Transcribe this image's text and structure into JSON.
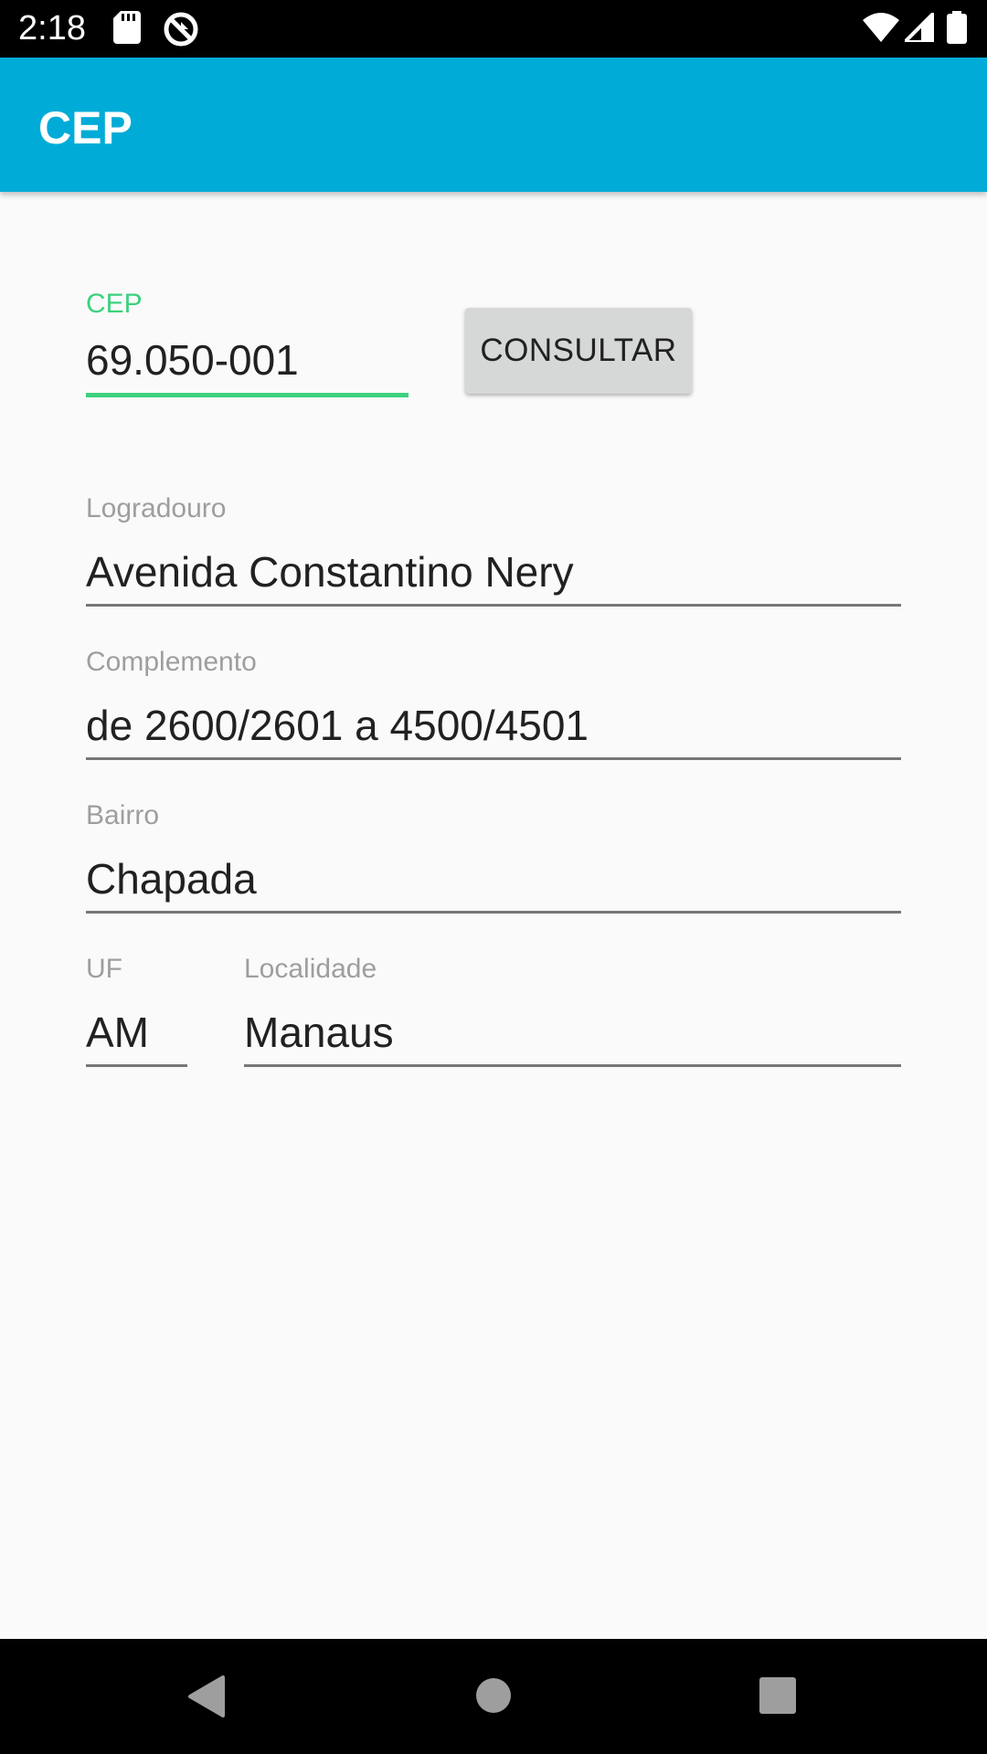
{
  "status_bar": {
    "time": "2:18",
    "icons": [
      "sd-card-icon",
      "no-sync-icon",
      "wifi-icon",
      "signal-icon",
      "battery-icon"
    ]
  },
  "app_bar": {
    "title": "CEP",
    "color": "#00acd7"
  },
  "form": {
    "cep": {
      "label": "CEP",
      "value": "69.050-001"
    },
    "consult_button": "CONSULTAR",
    "logradouro": {
      "label": "Logradouro",
      "value": "Avenida Constantino Nery"
    },
    "complemento": {
      "label": "Complemento",
      "value": "de 2600/2601 a 4500/4501"
    },
    "bairro": {
      "label": "Bairro",
      "value": "Chapada"
    },
    "uf": {
      "label": "UF",
      "value": "AM"
    },
    "localidade": {
      "label": "Localidade",
      "value": "Manaus"
    }
  },
  "colors": {
    "accent": "#3dd17e",
    "background": "#fafafa"
  },
  "nav_bar": {
    "buttons": [
      "back-icon",
      "home-icon",
      "recents-icon"
    ]
  }
}
